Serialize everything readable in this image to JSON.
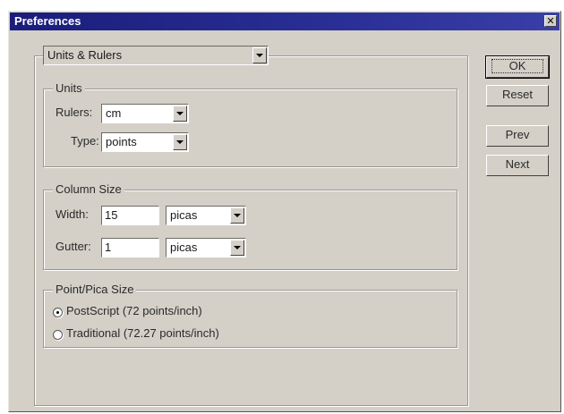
{
  "window": {
    "title": "Preferences",
    "close_glyph": "✕"
  },
  "section_select": {
    "value": "Units & Rulers"
  },
  "units": {
    "legend": "Units",
    "rulers_label": "Rulers:",
    "rulers_value": "cm",
    "type_label": "Type:",
    "type_value": "points"
  },
  "column_size": {
    "legend": "Column Size",
    "width_label": "Width:",
    "width_value": "15",
    "width_unit": "picas",
    "gutter_label": "Gutter:",
    "gutter_value": "1",
    "gutter_unit": "picas"
  },
  "point_pica": {
    "legend": "Point/Pica Size",
    "options": [
      "PostScript (72 points/inch)",
      "Traditional (72.27 points/inch)"
    ],
    "selected": "PostScript (72 points/inch)"
  },
  "buttons": {
    "ok": "OK",
    "reset": "Reset",
    "prev": "Prev",
    "next": "Next"
  }
}
